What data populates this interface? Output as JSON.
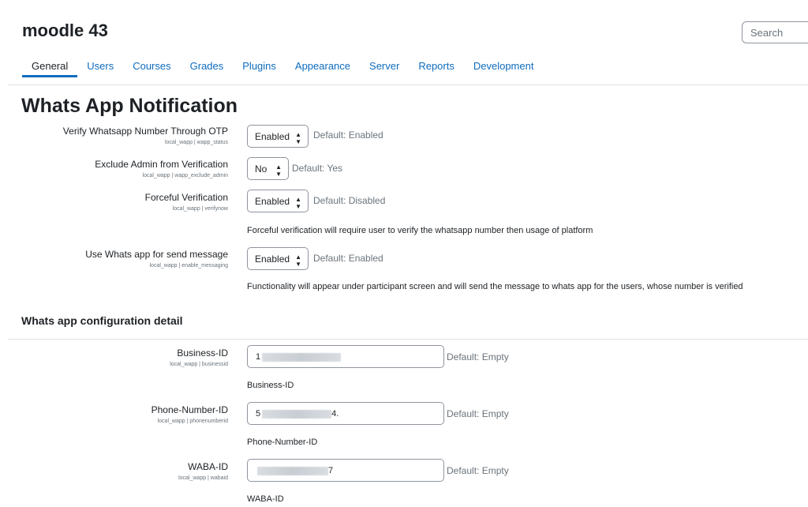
{
  "site": {
    "title": "moodle 43"
  },
  "search": {
    "placeholder": "Search"
  },
  "nav": {
    "tabs": [
      {
        "label": "General",
        "active": true
      },
      {
        "label": "Users"
      },
      {
        "label": "Courses"
      },
      {
        "label": "Grades"
      },
      {
        "label": "Plugins"
      },
      {
        "label": "Appearance"
      },
      {
        "label": "Server"
      },
      {
        "label": "Reports"
      },
      {
        "label": "Development"
      }
    ]
  },
  "page": {
    "title": "Whats App Notification"
  },
  "settings": [
    {
      "label": "Verify Whatsapp Number Through OTP",
      "key": "local_wapp | wapp_status",
      "value": "Enabled",
      "default": "Default: Enabled"
    },
    {
      "label": "Exclude Admin from Verification",
      "key": "local_wapp | wapp_exclude_admin",
      "value": "No",
      "default": "Default: Yes"
    },
    {
      "label": "Forceful Verification",
      "key": "local_wapp | verifynow",
      "value": "Enabled",
      "default": "Default: Disabled",
      "description": "Forceful verification will require user to verify the whatsapp number then usage of platform"
    },
    {
      "label": "Use Whats app for send message",
      "key": "local_wapp | enable_messaging",
      "value": "Enabled",
      "default": "Default: Enabled",
      "description": "Functionality will appear under participant screen and will send the message to whats app for the users, whose number is verified"
    }
  ],
  "config": {
    "title": "Whats app configuration detail",
    "fields": [
      {
        "label": "Business-ID",
        "key": "local_wapp | businessid",
        "value_visible_start": "1",
        "value_visible_end": "",
        "default": "Default: Empty",
        "description": "Business-ID"
      },
      {
        "label": "Phone-Number-ID",
        "key": "local_wapp | phonenumberid",
        "value_visible_start": "5",
        "value_visible_end": "4.",
        "default": "Default: Empty",
        "description": "Phone-Number-ID"
      },
      {
        "label": "WABA-ID",
        "key": "local_wapp | wabaid",
        "value_visible_start": "",
        "value_visible_end": "7",
        "default": "Default: Empty",
        "description": "WABA-ID"
      }
    ]
  },
  "icons": {
    "select_caret": "sort-caret-icon"
  }
}
